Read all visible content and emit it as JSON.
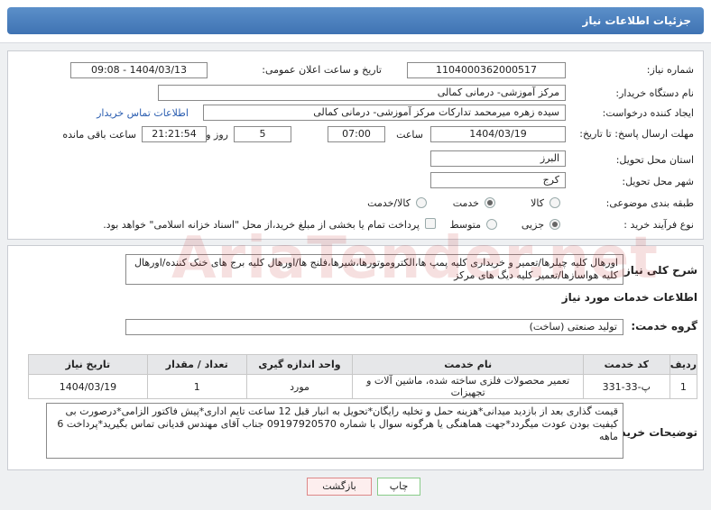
{
  "header": {
    "title": "جزئیات اطلاعات نیاز"
  },
  "form": {
    "need_number_label": "شماره نیاز:",
    "need_number": "1104000362000517",
    "announce_label": "تاریخ و ساعت اعلان عمومی:",
    "announce_value": "1404/03/13 - 09:08",
    "buyer_org_label": "نام دستگاه خریدار:",
    "buyer_org": "مرکز آموزشی- درمانی کمالی",
    "creator_label": "ایجاد کننده درخواست:",
    "creator": "سیده زهره میرمحمد تدارکات مرکز آموزشی- درمانی کمالی",
    "buyer_contact_link": "اطلاعات تماس خریدار",
    "deadline_label": "مهلت ارسال پاسخ: تا تاریخ:",
    "deadline_date": "1404/03/19",
    "time_label": "ساعت",
    "deadline_time": "07:00",
    "days_value": "5",
    "days_label": "روز و",
    "remaining_time": "21:21:54",
    "remaining_label": "ساعت باقی مانده",
    "province_label": "استان محل تحویل:",
    "province": "البرز",
    "city_label": "شهر محل تحویل:",
    "city": "کرج",
    "category_label": "طبقه بندی موضوعی:",
    "category_options": [
      "کالا",
      "خدمت",
      "کالا/خدمت"
    ],
    "process_label": "نوع فرآیند خرید :",
    "process_options": [
      "جزیی",
      "متوسط"
    ],
    "treasury_note": "پرداخت تمام یا بخشی از مبلغ خرید،از محل \"اسناد خزانه اسلامی\" خواهد بود."
  },
  "description": {
    "label": "شرح کلی نیاز:",
    "text": "اورهال کلیه چیلرها/تعمیر و خریداری کلیه پمپ ها،الکتروموتورها،شیرها،فلنج ها/اورهال کلیه برج های خنک کننده/اورهال کلیه هواسازها/تعمیر کلیه دیگ های مرکز"
  },
  "services": {
    "title": "اطلاعات خدمات مورد نیاز",
    "group_label": "گروه خدمت:",
    "group_value": "تولید صنعتی (ساخت)",
    "columns": [
      "ردیف",
      "کد خدمت",
      "نام خدمت",
      "واحد اندازه گیری",
      "تعداد / مقدار",
      "تاریخ نیاز"
    ],
    "rows": [
      [
        "1",
        "پ-33-331",
        "تعمیر محصولات فلزی ساخته شده، ماشین آلات و تجهیزات",
        "مورد",
        "1",
        "1404/03/19"
      ]
    ]
  },
  "buyer_notes": {
    "label": "توضیحات خریدار:",
    "text": "قیمت گذاری بعد از بازدید میدانی*هزینه حمل و تخلیه رایگان*تحویل به انبار قبل 12 ساعت تایم اداری*پیش فاکتور الزامی*درصورت بی کیفیت بودن عودت میگردد*جهت هماهنگی یا هرگونه سوال با شماره 09197920570 جناب آقای مهندس قدیانی تماس بگیرید*پرداخت 6 ماهه"
  },
  "buttons": {
    "print": "چاپ",
    "back": "بازگشت"
  },
  "watermark": "AriaTender.net"
}
